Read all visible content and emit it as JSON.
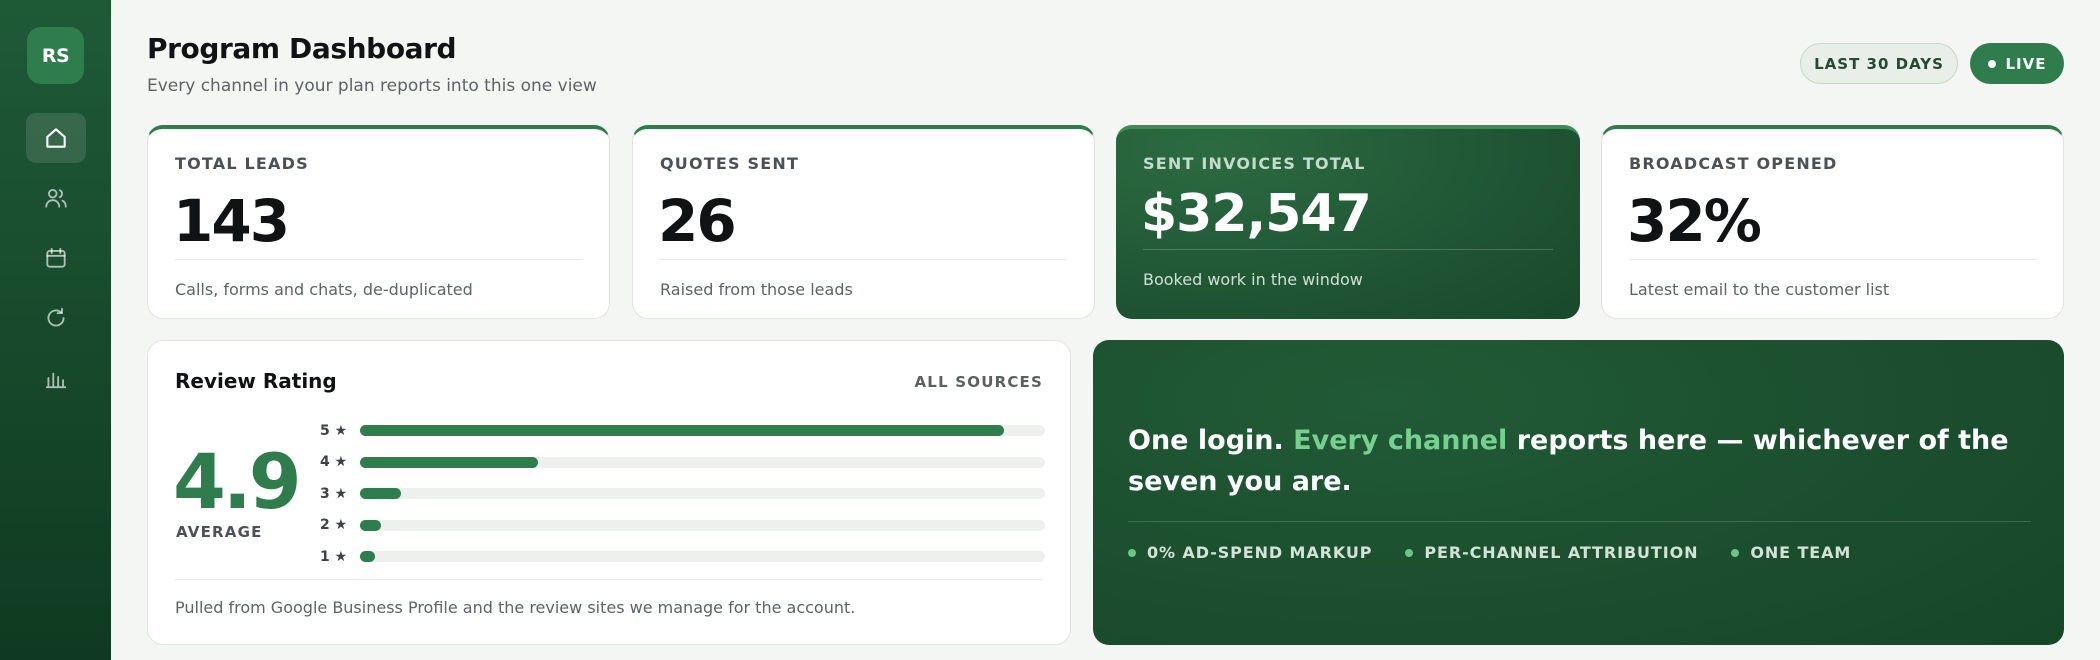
{
  "sidebar": {
    "logo": "RS",
    "nav_icons": [
      "home-icon",
      "users-icon",
      "calendar-icon",
      "refresh-icon",
      "bar-chart-icon"
    ]
  },
  "header": {
    "title": "Program Dashboard",
    "subtitle": "Every channel in your plan reports into this one view",
    "range_label": "LAST 30 DAYS",
    "live_label": "LIVE"
  },
  "kpis": [
    {
      "label": "TOTAL LEADS",
      "value": "143",
      "note": "Calls, forms and chats, de-duplicated"
    },
    {
      "label": "QUOTES SENT",
      "value": "26",
      "note": "Raised from those leads"
    },
    {
      "label": "SENT INVOICES TOTAL",
      "value": "$32,547",
      "note": "Booked work in the window"
    },
    {
      "label": "BROADCAST OPENED",
      "value": "32%",
      "note": "Latest email to the customer list"
    }
  ],
  "review": {
    "title": "Review Rating",
    "sources_label": "ALL SOURCES",
    "score": "4.9",
    "score_label": "AVERAGE",
    "distribution": [
      {
        "label": "5 ★",
        "fraction": 0.94
      },
      {
        "label": "4 ★",
        "fraction": 0.26
      },
      {
        "label": "3 ★",
        "fraction": 0.06
      },
      {
        "label": "2 ★",
        "fraction": 0.03
      },
      {
        "label": "1 ★",
        "fraction": 0.02
      }
    ],
    "footnote": "Pulled from Google Business Profile and the review sites we manage for the account."
  },
  "promo": {
    "headline_start": "One login. ",
    "headline_accent": "Every channel",
    "headline_end": " reports here — whichever of the seven you are.",
    "features": [
      "0% AD-SPEND MARKUP",
      "PER-CHANNEL ATTRIBUTION",
      "ONE TEAM"
    ]
  },
  "colors": {
    "brand_green": "#2f7d4c",
    "accent_light_green": "#76d08f",
    "sidebar_dark": "#174a2c"
  }
}
